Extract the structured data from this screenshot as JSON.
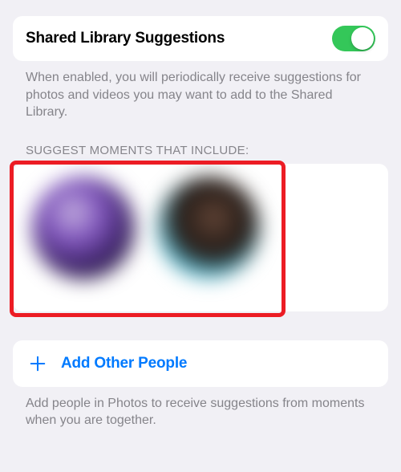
{
  "toggle": {
    "title": "Shared Library Suggestions",
    "enabled": true
  },
  "caption1": "When enabled, you will periodically receive suggestions for photos and videos you may want to add to the Shared Library.",
  "section_header": "SUGGEST MOMENTS THAT INCLUDE:",
  "add_button": {
    "label": "Add Other People"
  },
  "caption2": "Add people in Photos to receive suggestions from moments when you are together.",
  "colors": {
    "accent": "#007aff",
    "toggle_on": "#34c759",
    "highlight": "#ec1c24"
  }
}
